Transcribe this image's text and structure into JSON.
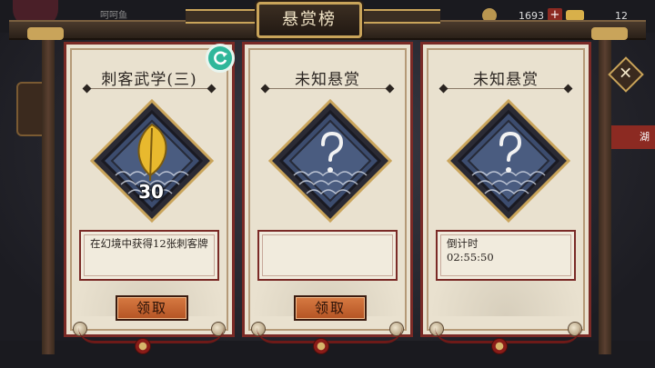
{
  "window": {
    "title": "悬赏榜"
  },
  "background": {
    "player_name": "呵呵鱼",
    "gold_amount": "1693",
    "ingot_amount": "12",
    "right_tab_label": "湖"
  },
  "cards": [
    {
      "title": "刺客武学(三)",
      "count": "30",
      "description": "在幻境中获得12张刺客牌",
      "button": "领取",
      "reward_icon": "golden-leaf-icon"
    },
    {
      "title": "未知悬赏",
      "count": "",
      "description": "",
      "button": "领取",
      "reward_icon": "question-mark-icon"
    },
    {
      "title": "未知悬赏",
      "count": "",
      "description": "倒计时\n02:55:50",
      "button": "",
      "reward_icon": "question-mark-icon"
    }
  ],
  "controls": {
    "close": "✕",
    "refresh": "refresh-icon"
  },
  "colors": {
    "card_bg": "#e9e1cf",
    "card_border": "#7a2a26",
    "button": "#c8683a",
    "refresh": "#2fb79a",
    "gold_trim": "#c9a45a"
  }
}
